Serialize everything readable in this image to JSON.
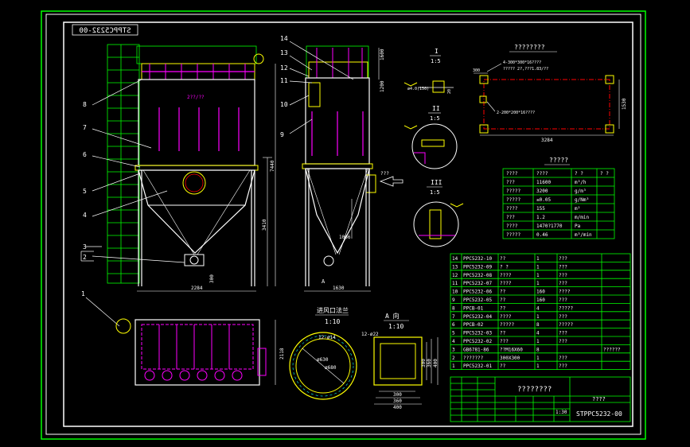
{
  "drawing": {
    "number": "STPPC5232-00",
    "number_mirrored": "STPPC5232-00",
    "colors": {
      "frame": "#ffffff",
      "border": "#00ff00",
      "outline": "#ffffff",
      "body": "#ff00ff",
      "steel": "#ffff00",
      "label": "#00ffff",
      "text": "#ffffff"
    }
  },
  "front_view": {
    "callouts": [
      "1",
      "2",
      "3",
      "4",
      "5",
      "6",
      "7",
      "8"
    ],
    "dims": {
      "width": "2284",
      "height_total": "7440",
      "height_lower": "3410",
      "height_base": "300"
    },
    "note": "2??/??"
  },
  "side_view": {
    "callouts": [
      "14",
      "13",
      "12",
      "11",
      "10",
      "9"
    ],
    "dims": {
      "width": "1630",
      "lower": "1066",
      "top": "1600",
      "mid": "1200"
    },
    "section_marker": "A",
    "inlet_label": "???"
  },
  "plan_view": {
    "dims": {
      "h": "2118"
    }
  },
  "flange": {
    "title": "进风口法兰",
    "scale": "1:10",
    "note": "12-ø14",
    "d1": "ø630",
    "d2": "ø680"
  },
  "view_a": {
    "title": "A 向",
    "scale": "1:10",
    "note": "12-ø22",
    "dims": {
      "w1": "300",
      "w2": "360",
      "w3": "400",
      "h1": "300",
      "h2": "360",
      "h3": "400"
    }
  },
  "details": [
    {
      "roman": "I",
      "scale": "1:5",
      "note": "ø4.0(150)",
      "dim": "20"
    },
    {
      "roman": "II",
      "scale": "1:5"
    },
    {
      "roman": "III",
      "scale": "1:5"
    }
  ],
  "foundation": {
    "title": "????????",
    "note1": "4-300*300*16????",
    "note2": "????? 2?,???1.83/??",
    "note3": "2-200*200*16????",
    "dims": {
      "a": "300",
      "b": "3284",
      "c": "1530"
    }
  },
  "spec_table": {
    "title": "?????",
    "headers": [
      "????",
      "????",
      "?  ?",
      "?  ?"
    ],
    "rows": [
      [
        "???",
        "11600",
        "m³/h"
      ],
      [
        "?????",
        "3200",
        "g/m³"
      ],
      [
        "?????",
        "≤0.05",
        "g/Nm³"
      ],
      [
        "????",
        "155",
        "m²"
      ],
      [
        "???",
        "1.2",
        "m/min"
      ],
      [
        "????",
        "1470?1770",
        "Pa"
      ],
      [
        "?????",
        "0.46",
        "m³/min"
      ]
    ]
  },
  "bom": {
    "rows": [
      [
        "14",
        "PPC5232-10",
        "??",
        "1",
        "???",
        ""
      ],
      [
        "13",
        "PPC5232-09",
        "? ?",
        "1",
        "???",
        ""
      ],
      [
        "12",
        "PPC5232-08",
        "????",
        "1",
        "???",
        ""
      ],
      [
        "11",
        "PPC5232-07",
        "????",
        "1",
        "???",
        ""
      ],
      [
        "10",
        "PPC5232-06",
        "??",
        "160",
        "????",
        ""
      ],
      [
        "9",
        "PPC5232-05",
        "??",
        "160",
        "???",
        ""
      ],
      [
        "8",
        "PPCB-01",
        "??",
        "4",
        "?????",
        ""
      ],
      [
        "7",
        "PPC5232-04",
        "????",
        "1",
        "???",
        ""
      ],
      [
        "6",
        "PPCB-02",
        "?????",
        "8",
        "?????",
        ""
      ],
      [
        "5",
        "PPC5232-03",
        "??",
        "4",
        "???",
        ""
      ],
      [
        "4",
        "PPC5232-02",
        "???",
        "1",
        "???",
        ""
      ],
      [
        "3",
        "GB6781-86",
        "??M16X60",
        "8",
        "",
        "??????"
      ],
      [
        "2",
        "???????",
        "300X300",
        "1",
        "???",
        ""
      ],
      [
        "1",
        "PPC5232-01",
        "??",
        "1",
        "???",
        ""
      ]
    ]
  },
  "title_block": {
    "name": "????????",
    "company": "????",
    "scale": "1:30",
    "number": "STPPC5232-00"
  }
}
